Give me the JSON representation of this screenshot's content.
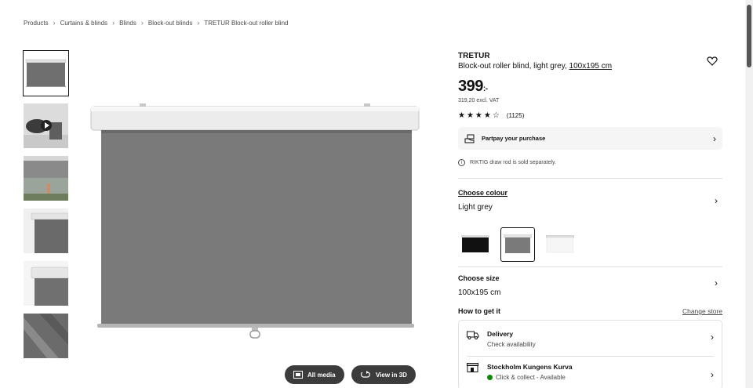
{
  "breadcrumb": [
    "Products",
    "Curtains & blinds",
    "Blinds",
    "Block-out blinds",
    "TRETUR Block-out roller blind"
  ],
  "media_buttons": {
    "all_media": "All media",
    "view_3d": "View in 3D"
  },
  "product": {
    "brand": "TRETUR",
    "description": "Block-out roller blind, light grey, ",
    "size_link": "100x195 cm",
    "price": "399",
    "price_suffix": ":-",
    "excl_vat": "319,20 excl. VAT",
    "stars": "★★★★☆",
    "rating_count": "(1125)"
  },
  "partpay": {
    "label": "Partpay your purchase"
  },
  "note": "RIKTIG draw rod is sold separately.",
  "colour": {
    "title": "Choose colour",
    "value": "Light grey"
  },
  "size": {
    "title": "Choose size",
    "value": "100x195 cm"
  },
  "get_it": {
    "title": "How to get it",
    "change_store": "Change store"
  },
  "delivery": {
    "title": "Delivery",
    "sub": "Check availability"
  },
  "store": {
    "title": "Stockholm Kungens Kurva",
    "sub": "Click & collect - Available"
  },
  "colors": {
    "blind": "#7a7a7a",
    "rail": "#ececec",
    "accent": "#0a8a00"
  }
}
